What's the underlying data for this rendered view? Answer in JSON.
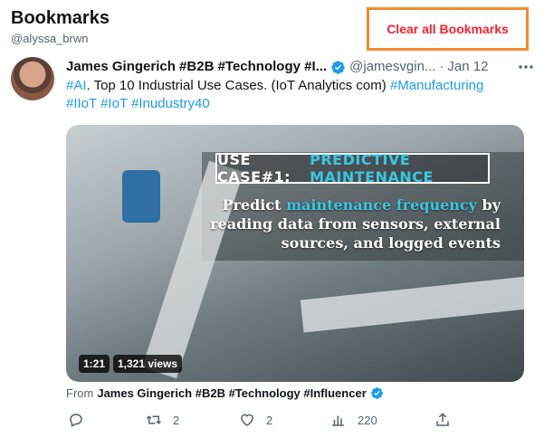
{
  "header": {
    "title": "Bookmarks",
    "handle": "@alyssa_brwn"
  },
  "clear_button": {
    "label": "Clear all Bookmarks"
  },
  "tweet": {
    "author_name": "James Gingerich #B2B #Technology #I...",
    "author_handle": "@jamesvgin...",
    "separator": "·",
    "date": "Jan 12",
    "text": {
      "tag_ai": "#AI",
      "body": ".  Top 10 Industrial Use Cases.  (IoT Analytics com) ",
      "tag_manufacturing": "#Manufacturing",
      "tag_iiot": "#IIoT",
      "tag_iot": "#IoT",
      "tag_industry40": "#Inudustry40"
    },
    "media": {
      "usecase_label": "USE CASE#1:",
      "usecase_highlight": "PREDICTIVE MAINTENANCE",
      "overlay_pre": "Predict ",
      "overlay_highlight": "maintenance frequency",
      "overlay_post": " by reading data from sensors, external sources, and logged events",
      "duration": "1:21",
      "views": "1,321 views"
    },
    "from_label": "From",
    "from_name": "James Gingerich #B2B #Technology #Influencer",
    "actions": {
      "replies": "",
      "retweets": "2",
      "likes": "2",
      "views": "220"
    }
  },
  "icons": {
    "verified": "verified-badge-icon",
    "more": "more-icon",
    "reply": "reply-icon",
    "retweet": "retweet-icon",
    "like": "heart-icon",
    "analytics": "analytics-icon",
    "share": "share-icon"
  },
  "colors": {
    "accent": "#1d9bf0",
    "danger": "#f4212e",
    "highlight_border": "#f58a2c",
    "media_highlight": "#39c7e2"
  }
}
